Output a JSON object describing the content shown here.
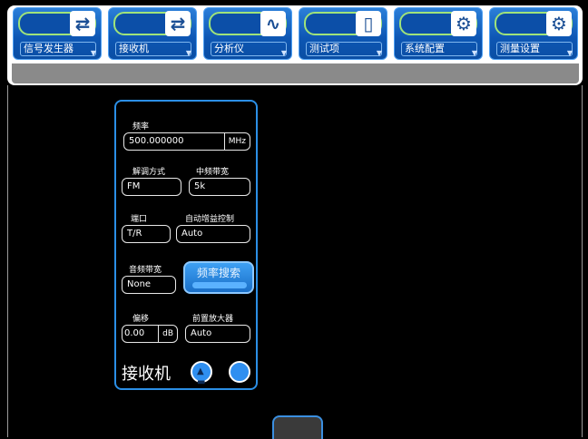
{
  "toolbar": {
    "tabs": [
      {
        "label": "信号发生器",
        "icon": "⇄"
      },
      {
        "label": "接收机",
        "icon": "⇄"
      },
      {
        "label": "分析仪",
        "icon": "∿"
      },
      {
        "label": "测试项",
        "icon": "▯"
      },
      {
        "label": "系统配置",
        "icon": "⚙"
      },
      {
        "label": "测量设置",
        "icon": "⚙"
      }
    ]
  },
  "panel": {
    "frequency": {
      "label": "频率",
      "value": "500.000000",
      "unit": "MHz"
    },
    "demod": {
      "label": "解调方式",
      "value": "FM"
    },
    "if_bw": {
      "label": "中频带宽",
      "value": "5k"
    },
    "port": {
      "label": "端口",
      "value": "T/R"
    },
    "agc": {
      "label": "自动增益控制",
      "value": "Auto"
    },
    "audio_bw": {
      "label": "音频带宽",
      "value": "None"
    },
    "freq_search": {
      "label": "频率搜索"
    },
    "offset": {
      "label": "偏移",
      "value": "0.00",
      "unit": "dB"
    },
    "preamp": {
      "label": "前置放大器",
      "value": "Auto"
    },
    "title": "接收机"
  },
  "colors": {
    "accent": "#2b8fe6",
    "active_pill": "#9fe37a"
  }
}
